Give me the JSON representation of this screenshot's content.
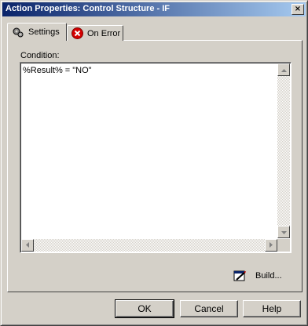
{
  "window": {
    "title": "Action Properties: Control Structure - IF",
    "close_glyph": "×"
  },
  "tabs": [
    {
      "label": "Settings",
      "icon": "gear-icon",
      "active": true
    },
    {
      "label": "On Error",
      "icon": "error-x-icon",
      "active": false
    }
  ],
  "settings": {
    "condition_label": "Condition:",
    "condition_value": "%Result% = \"NO\""
  },
  "build_button": {
    "label": "Build...",
    "icon": "build-wizard-icon"
  },
  "buttons": {
    "ok": "OK",
    "cancel": "Cancel",
    "help": "Help"
  }
}
